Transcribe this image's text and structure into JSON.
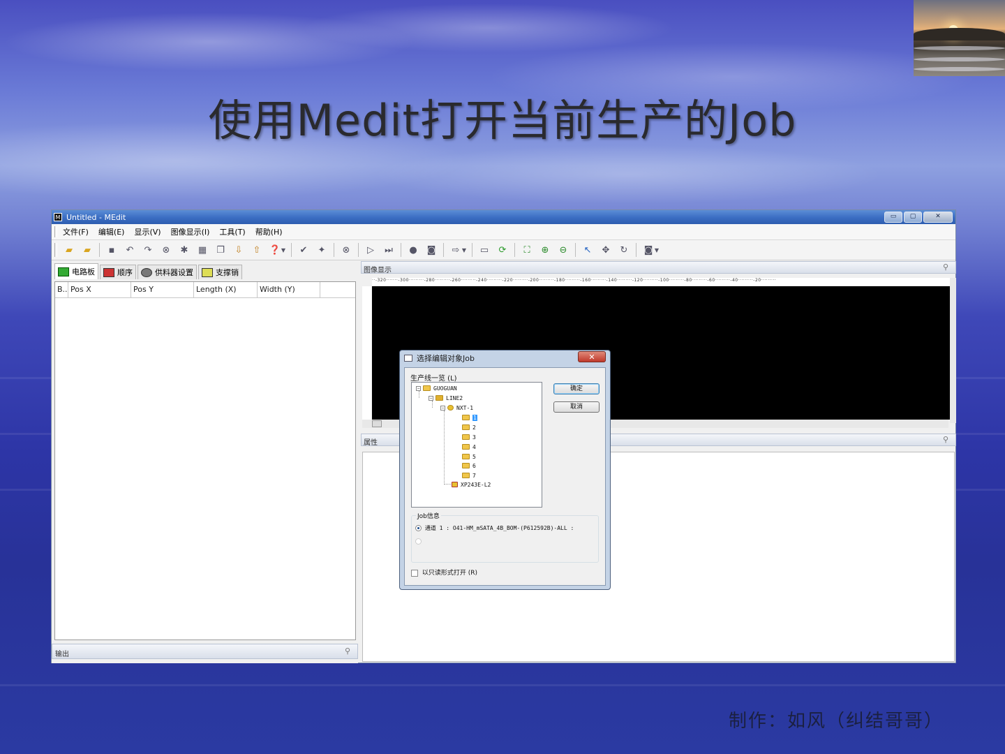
{
  "slide": {
    "title": "使用Medit打开当前生产的Job",
    "credit": "制作：如风（纠结哥哥）"
  },
  "window": {
    "app_icon_letter": "M",
    "title": "Untitled - MEdit",
    "buttons": {
      "minimize": "▭",
      "restore": "▢",
      "close": "✕"
    }
  },
  "menu": {
    "items": [
      "文件(F)",
      "编辑(E)",
      "显示(V)",
      "图像显示(I)",
      "工具(T)",
      "帮助(H)"
    ]
  },
  "left_panel": {
    "tabs": [
      "电路板",
      "顺序",
      "供料器设置",
      "支撑销"
    ],
    "columns": [
      "B..",
      "Pos X",
      "Pos Y",
      "Length (X)",
      "Width (Y)"
    ],
    "output_label": "输出"
  },
  "image_panel": {
    "title": "图像显示",
    "ruler_text": "··-320·······-300·········-280·········-260·········-240·········-220·········-200·········-180·········-160·········-140·········-120·········-100·········-80·········-60·········-40·········-20·········"
  },
  "property_panel": {
    "title": "属性"
  },
  "dialog": {
    "title": "选择编辑对象Job",
    "close": "✕",
    "tree_label": "生产线一览 (L)",
    "tree": {
      "root": "GUOGUAN",
      "line": "LINE2",
      "machine": "NXT-1",
      "modules": [
        "1",
        "2",
        "3",
        "4",
        "5",
        "6",
        "7"
      ],
      "other_machine": "XP243E-L2"
    },
    "ok_label": "确定",
    "cancel_label": "取消",
    "job_info_label": "Job信息",
    "job_option_1": "通道 1 : O41-HM_mSATA_4B_BOM-(P612592B)-ALL :",
    "readonly_label": "以只读形式打开 (R)"
  }
}
